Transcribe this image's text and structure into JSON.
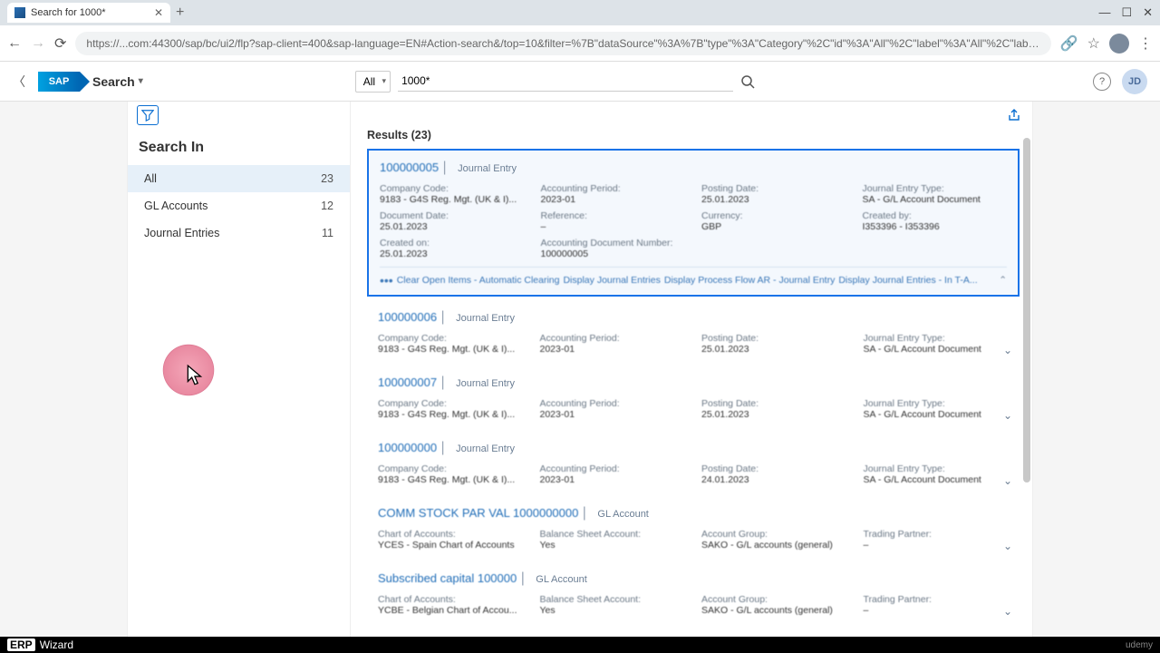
{
  "browser": {
    "tab_title": "Search for 1000*",
    "url": "https://...com:44300/sap/bc/ui2/flp?sap-client=400&sap-language=EN#Action-search&/top=10&filter=%7B\"dataSource\"%3A%7B\"type\"%3A\"Category\"%2C\"id\"%3A\"All\"%2C\"label\"%3A\"All\"%2C\"labelPlural\"%3A\"All\"%7D%2C\"se..."
  },
  "header": {
    "logo_text": "SAP",
    "title": "Search",
    "filter_label": "All",
    "search_value": "1000*",
    "user_initials": "JD"
  },
  "sidebar": {
    "title": "Search In",
    "items": [
      {
        "label": "All",
        "count": "23",
        "active": true
      },
      {
        "label": "GL Accounts",
        "count": "12",
        "active": false
      },
      {
        "label": "Journal Entries",
        "count": "11",
        "active": false
      }
    ]
  },
  "results": {
    "header": "Results (23)",
    "items": [
      {
        "id": "100000005",
        "tag": "Journal Entry",
        "selected": true,
        "expanded": true,
        "fields": [
          {
            "label": "Company Code:",
            "value": "9183 - G4S Reg. Mgt. (UK & I)..."
          },
          {
            "label": "Accounting Period:",
            "value": "2023-01"
          },
          {
            "label": "Posting Date:",
            "value": "25.01.2023"
          },
          {
            "label": "Journal Entry Type:",
            "value": "SA - G/L Account Document"
          },
          {
            "label": "Document Date:",
            "value": "25.01.2023"
          },
          {
            "label": "Reference:",
            "value": "–"
          },
          {
            "label": "Currency:",
            "value": "GBP"
          },
          {
            "label": "Created by:",
            "value": "I353396 - I353396"
          },
          {
            "label": "Created on:",
            "value": "25.01.2023"
          },
          {
            "label": "Accounting Document Number:",
            "value": "100000005"
          }
        ],
        "actions": [
          "Clear Open Items - Automatic Clearing",
          "Display Journal Entries",
          "Display Process Flow AR - Journal Entry",
          "Display Journal Entries - In T-A..."
        ]
      },
      {
        "id": "100000006",
        "tag": "Journal Entry",
        "fields": [
          {
            "label": "Company Code:",
            "value": "9183 - G4S Reg. Mgt. (UK & I)..."
          },
          {
            "label": "Accounting Period:",
            "value": "2023-01"
          },
          {
            "label": "Posting Date:",
            "value": "25.01.2023"
          },
          {
            "label": "Journal Entry Type:",
            "value": "SA - G/L Account Document"
          }
        ]
      },
      {
        "id": "100000007",
        "tag": "Journal Entry",
        "fields": [
          {
            "label": "Company Code:",
            "value": "9183 - G4S Reg. Mgt. (UK & I)..."
          },
          {
            "label": "Accounting Period:",
            "value": "2023-01"
          },
          {
            "label": "Posting Date:",
            "value": "25.01.2023"
          },
          {
            "label": "Journal Entry Type:",
            "value": "SA - G/L Account Document"
          }
        ]
      },
      {
        "id": "100000000",
        "tag": "Journal Entry",
        "fields": [
          {
            "label": "Company Code:",
            "value": "9183 - G4S Reg. Mgt. (UK & I)..."
          },
          {
            "label": "Accounting Period:",
            "value": "2023-01"
          },
          {
            "label": "Posting Date:",
            "value": "24.01.2023"
          },
          {
            "label": "Journal Entry Type:",
            "value": "SA - G/L Account Document"
          }
        ]
      },
      {
        "id": "COMM STOCK PAR VAL 1000000000",
        "tag": "GL Account",
        "fields": [
          {
            "label": "Chart of Accounts:",
            "value": "YCES - Spain Chart of Accounts"
          },
          {
            "label": "Balance Sheet Account:",
            "value": "Yes"
          },
          {
            "label": "Account Group:",
            "value": "SAKO - G/L accounts (general)"
          },
          {
            "label": "Trading Partner:",
            "value": "–"
          }
        ]
      },
      {
        "id": "Subscribed capital 100000",
        "tag": "GL Account",
        "fields": [
          {
            "label": "Chart of Accounts:",
            "value": "YCBE - Belgian Chart of Accou..."
          },
          {
            "label": "Balance Sheet Account:",
            "value": "Yes"
          },
          {
            "label": "Account Group:",
            "value": "SAKO - G/L accounts (general)"
          },
          {
            "label": "Trading Partner:",
            "value": "–"
          }
        ]
      }
    ]
  },
  "footer": {
    "brand1": "ERP",
    "brand2": "Wizard",
    "right": "udemy"
  }
}
